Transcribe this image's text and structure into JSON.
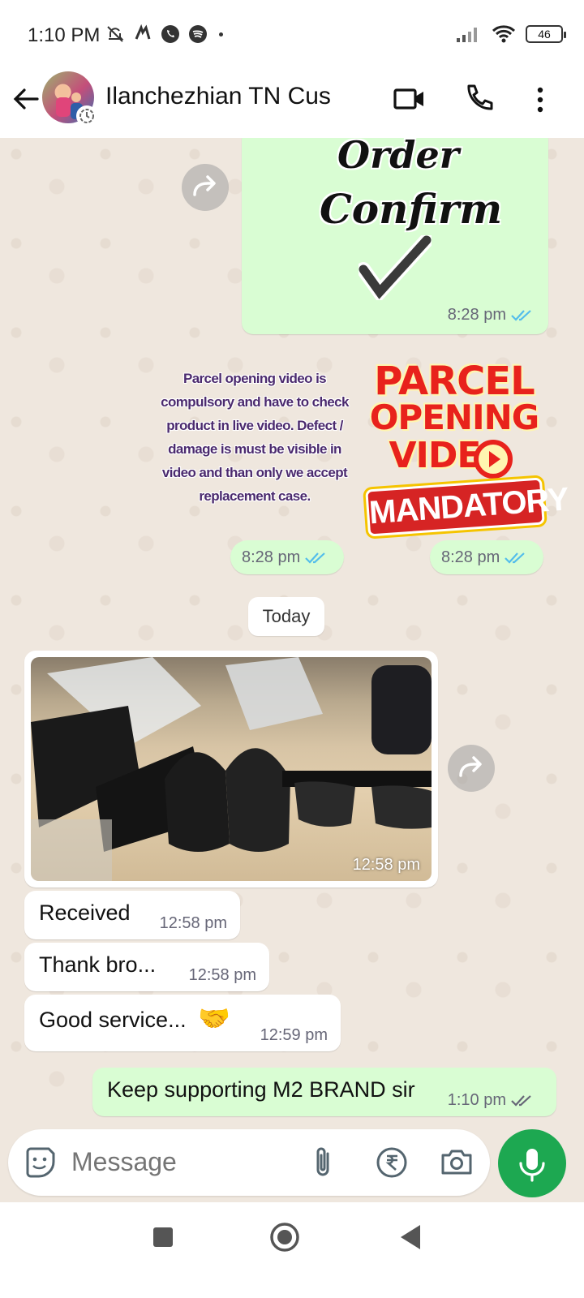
{
  "status_bar": {
    "time": "1:10 PM",
    "battery": "46"
  },
  "header": {
    "contact_name": "Ilanchezhian TN Cus"
  },
  "messages": [
    {
      "sticker_text_1": "Order",
      "sticker_text_2": "Confirm",
      "time": "8:28 pm"
    },
    {
      "notice": "Parcel opening video is compulsory and have to check product in live video. Defect / damage is must be visible in video and than only we accept replacement case.",
      "time": "8:28 pm"
    },
    {
      "sticker_lines": [
        "PARCEL",
        "OPENING",
        "VIDE"
      ],
      "banner": "MANDATORY",
      "time": "8:28 pm"
    }
  ],
  "date_divider": "Today",
  "incoming": [
    {
      "time": "12:58 pm"
    },
    {
      "text": "Received",
      "time": "12:58 pm"
    },
    {
      "text": "Thank bro...",
      "time": "12:58 pm"
    },
    {
      "text": "Good service...",
      "emoji": "🤝",
      "time": "12:59 pm"
    }
  ],
  "outgoing_last": {
    "text": "Keep supporting M2 BRAND sir",
    "time": "1:10 pm"
  },
  "composer": {
    "placeholder": "Message"
  },
  "colors": {
    "out_bubble": "#d9fdd3",
    "mic": "#1da851",
    "read_tick": "#53bdeb"
  }
}
